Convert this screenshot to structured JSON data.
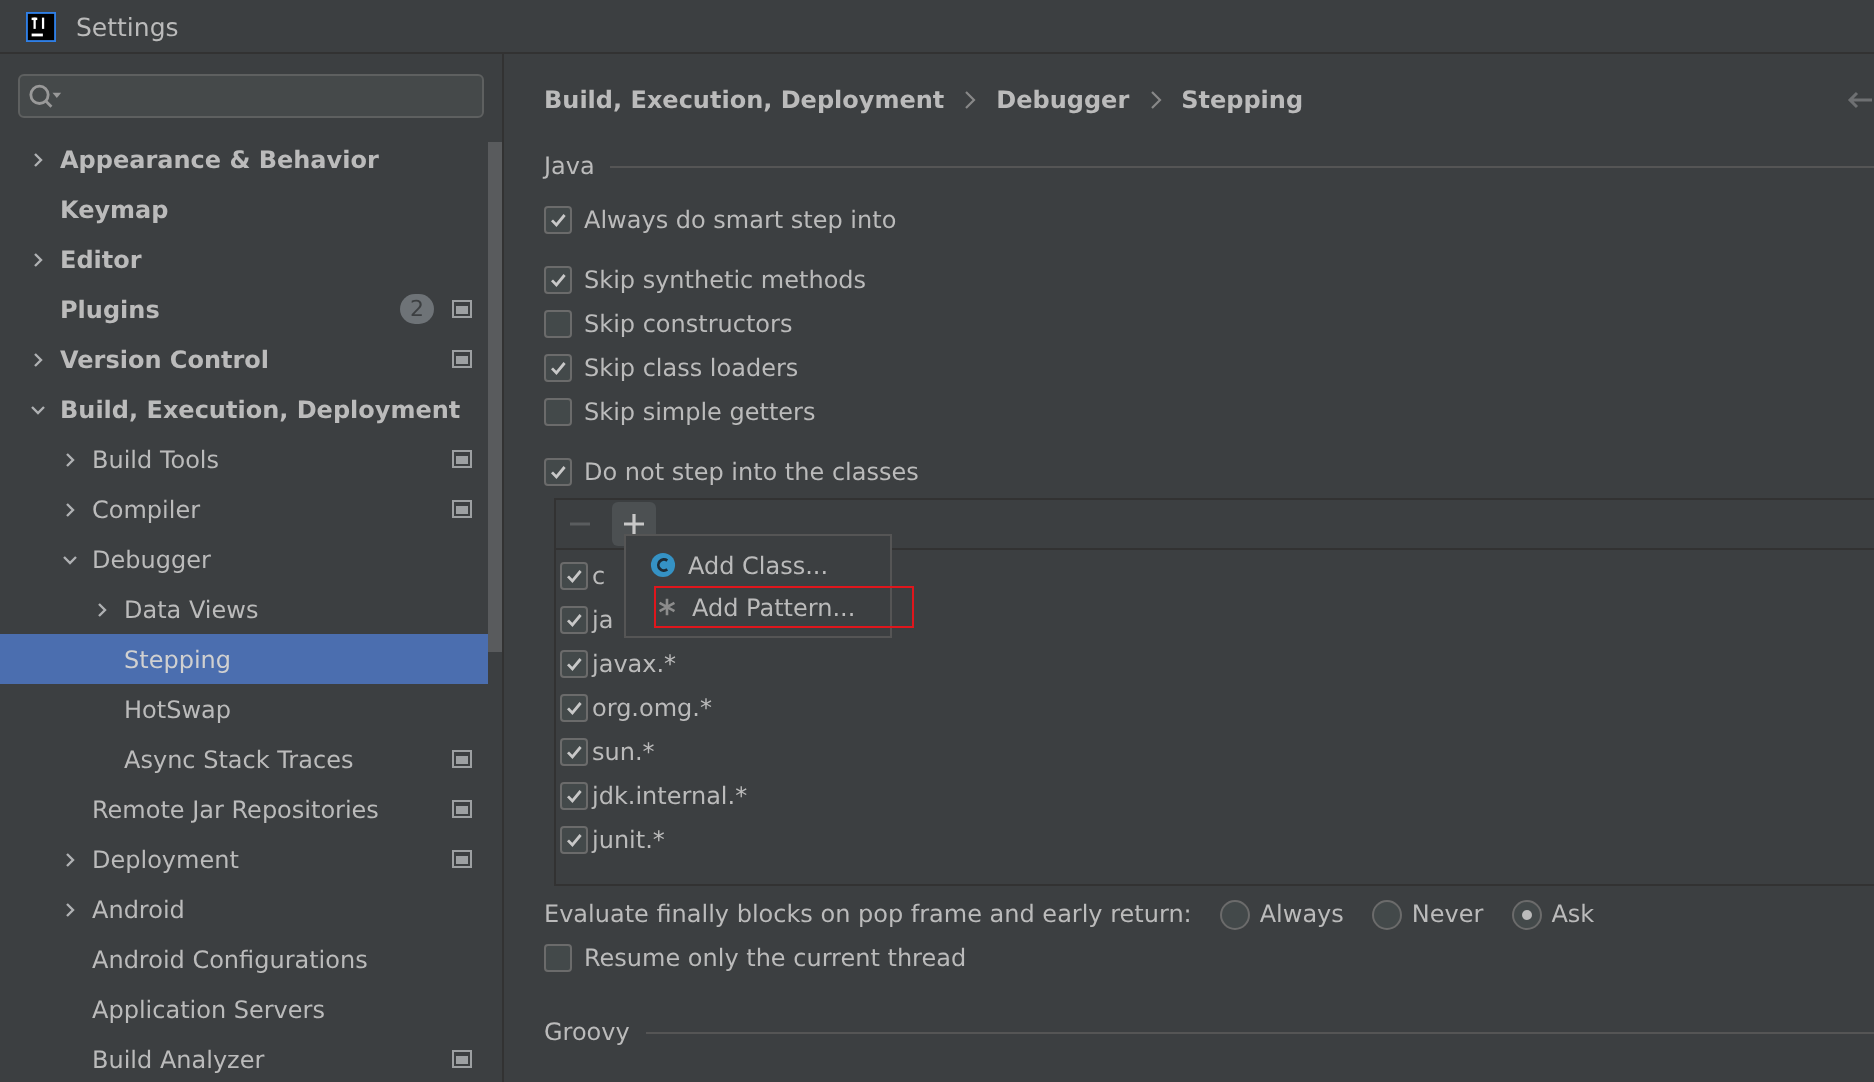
{
  "window": {
    "title": "Settings"
  },
  "sidebar": {
    "items": [
      {
        "label": "Appearance & Behavior",
        "expanded": false,
        "project_level": false
      },
      {
        "label": "Keymap",
        "project_level": false
      },
      {
        "label": "Editor",
        "expanded": false,
        "project_level": false
      },
      {
        "label": "Plugins",
        "badge": "2",
        "project_level": true
      },
      {
        "label": "Version Control",
        "expanded": false,
        "project_level": true
      },
      {
        "label": "Build, Execution, Deployment",
        "expanded": true,
        "project_level": false,
        "children": [
          {
            "label": "Build Tools",
            "expanded": false,
            "project_level": true
          },
          {
            "label": "Compiler",
            "expanded": false,
            "project_level": true
          },
          {
            "label": "Debugger",
            "expanded": true,
            "project_level": false,
            "children": [
              {
                "label": "Data Views",
                "expanded": false,
                "project_level": false
              },
              {
                "label": "Stepping",
                "selected": true,
                "project_level": false
              },
              {
                "label": "HotSwap",
                "selected": false,
                "project_level": false
              },
              {
                "label": "Async Stack Traces",
                "selected": false,
                "project_level": true
              }
            ]
          },
          {
            "label": "Remote Jar Repositories",
            "project_level": true
          },
          {
            "label": "Deployment",
            "expanded": false,
            "project_level": true
          },
          {
            "label": "Android",
            "expanded": false,
            "project_level": false
          },
          {
            "label": "Android Configurations",
            "project_level": false
          },
          {
            "label": "Application Servers",
            "project_level": false
          },
          {
            "label": "Build Analyzer",
            "project_level": true
          }
        ]
      }
    ]
  },
  "breadcrumb": [
    "Build, Execution, Deployment",
    "Debugger",
    "Stepping"
  ],
  "java": {
    "title": "Java",
    "option_groups": [
      [
        {
          "label": "Always do smart step into",
          "checked": true
        }
      ],
      [
        {
          "label": "Skip synthetic methods",
          "checked": true
        },
        {
          "label": "Skip constructors",
          "checked": false
        },
        {
          "label": "Skip class loaders",
          "checked": true
        },
        {
          "label": "Skip simple getters",
          "checked": false
        }
      ],
      [
        {
          "label": "Do not step into the classes",
          "checked": true
        }
      ]
    ],
    "class_list": {
      "rows": [
        {
          "label": "c",
          "checked": true
        },
        {
          "label": "ja",
          "checked": true
        },
        {
          "label": "javax.*",
          "checked": true
        },
        {
          "label": "org.omg.*",
          "checked": true
        },
        {
          "label": "sun.*",
          "checked": true
        },
        {
          "label": "jdk.internal.*",
          "checked": true
        },
        {
          "label": "junit.*",
          "checked": true
        }
      ]
    },
    "add_menu": [
      {
        "kind": "class",
        "label": "Add Class..."
      },
      {
        "kind": "pattern",
        "label": "Add Pattern...",
        "highlighted": true
      }
    ],
    "finally_blocks": {
      "label": "Evaluate finally blocks on pop frame and early return:",
      "options": [
        {
          "label": "Always",
          "selected": false
        },
        {
          "label": "Never",
          "selected": false
        },
        {
          "label": "Ask",
          "selected": true
        }
      ]
    },
    "resume_thread": {
      "label": "Resume only the current thread",
      "checked": false
    }
  },
  "groovy": {
    "title": "Groovy"
  }
}
